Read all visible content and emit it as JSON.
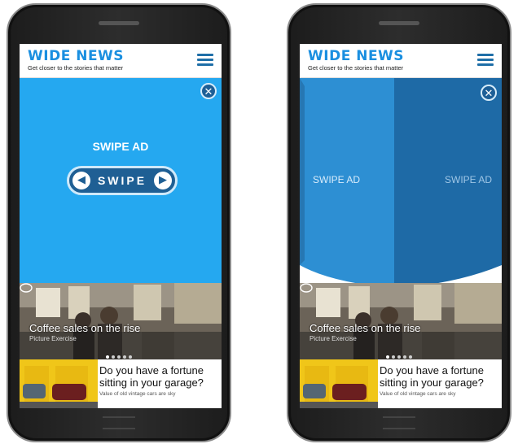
{
  "header": {
    "logo": "WIDE NEWS",
    "tagline": "Get closer to the stories that matter"
  },
  "ad_left": {
    "title": "SWIPE AD",
    "button_label": "SWIPE",
    "close_symbol": "✕",
    "prev_arrow": "◀",
    "next_arrow": "▶"
  },
  "ad_right": {
    "left_face_label": "SWIPE AD",
    "right_face_label": "SWIPE AD",
    "close_symbol": "✕"
  },
  "photo_card": {
    "title": "Coffee sales on the rise",
    "subtitle": "Picture Exercise"
  },
  "article": {
    "headline": "Do you have a fortune sitting in your garage?",
    "snippet": "Value of old vintage cars are sky"
  },
  "colors": {
    "ad_blue": "#25a8f0",
    "ad_dark_blue": "#1f6aa5",
    "logo_blue": "#1a8fe0"
  },
  "icons": [
    "close-icon",
    "menu-icon",
    "chevron-left-icon",
    "chevron-right-icon",
    "chat-icon"
  ]
}
